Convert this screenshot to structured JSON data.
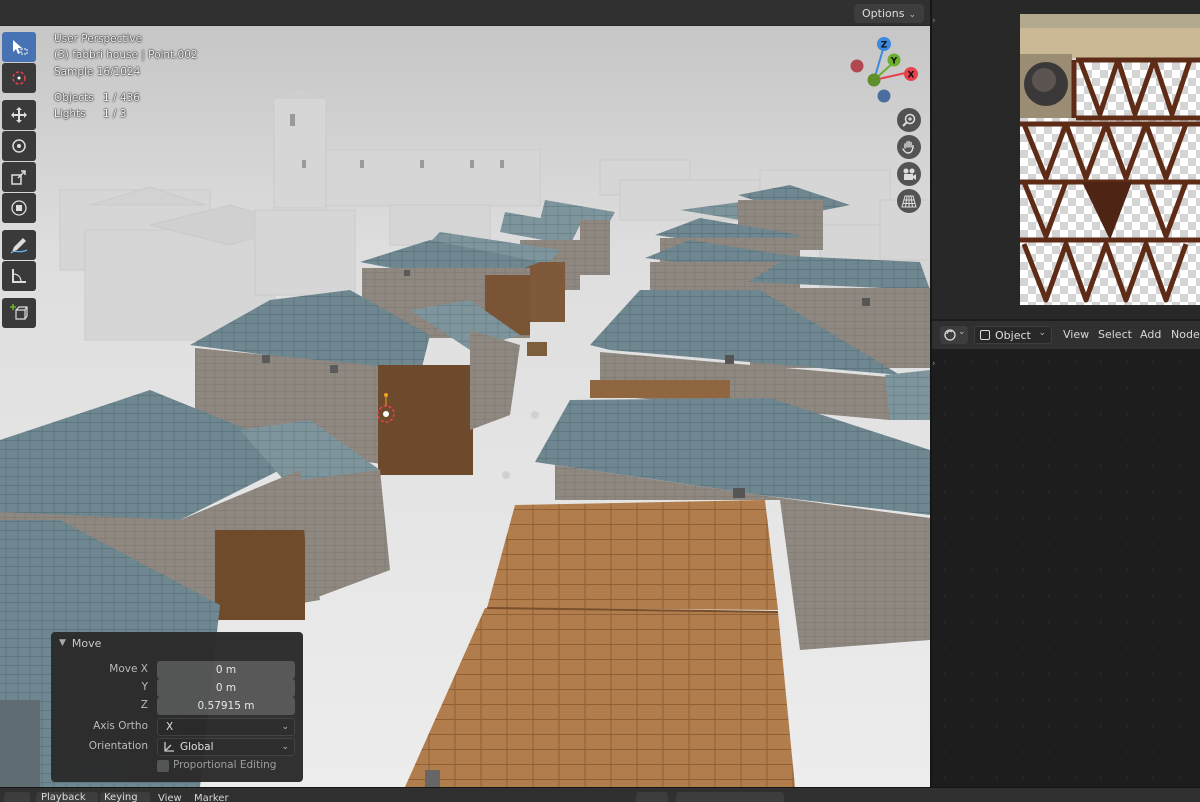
{
  "viewport": {
    "options_label": "Options",
    "view_name": "User Perspective",
    "object_path": "(3) fabbri house | Point.002",
    "sample": "Sample 16/1024",
    "stats": {
      "objects_label": "Objects",
      "objects_value": "1 / 436",
      "lights_label": "Lights",
      "lights_value": "1 / 3"
    },
    "gizmo": {
      "x": "X",
      "y": "Y",
      "z": "Z"
    },
    "toolbar": [
      "select-box",
      "cursor",
      "move",
      "rotate",
      "scale",
      "transform",
      "annotate",
      "measure",
      "add-cube"
    ],
    "nav_buttons": [
      "zoom",
      "pan",
      "camera",
      "perspective"
    ]
  },
  "move_panel": {
    "title": "Move",
    "move_x_label": "Move X",
    "move_x": "0 m",
    "y_label": "Y",
    "y": "0 m",
    "z_label": "Z",
    "z": "0.57915 m",
    "axis_ortho_label": "Axis Ortho",
    "axis_ortho": "X",
    "orientation_label": "Orientation",
    "orientation": "Global",
    "proportional_label": "Proportional Editing"
  },
  "node_editor": {
    "mode": "Object",
    "menu": [
      "View",
      "Select",
      "Add",
      "Node"
    ]
  },
  "timeline": {
    "playback": "Playback",
    "keying": "Keying",
    "view": "View",
    "marker": "Marker"
  },
  "colors": {
    "accent": "#4772b3",
    "axis_x": "#e8414e",
    "axis_y": "#6ab02c",
    "axis_z": "#3c89e0"
  }
}
